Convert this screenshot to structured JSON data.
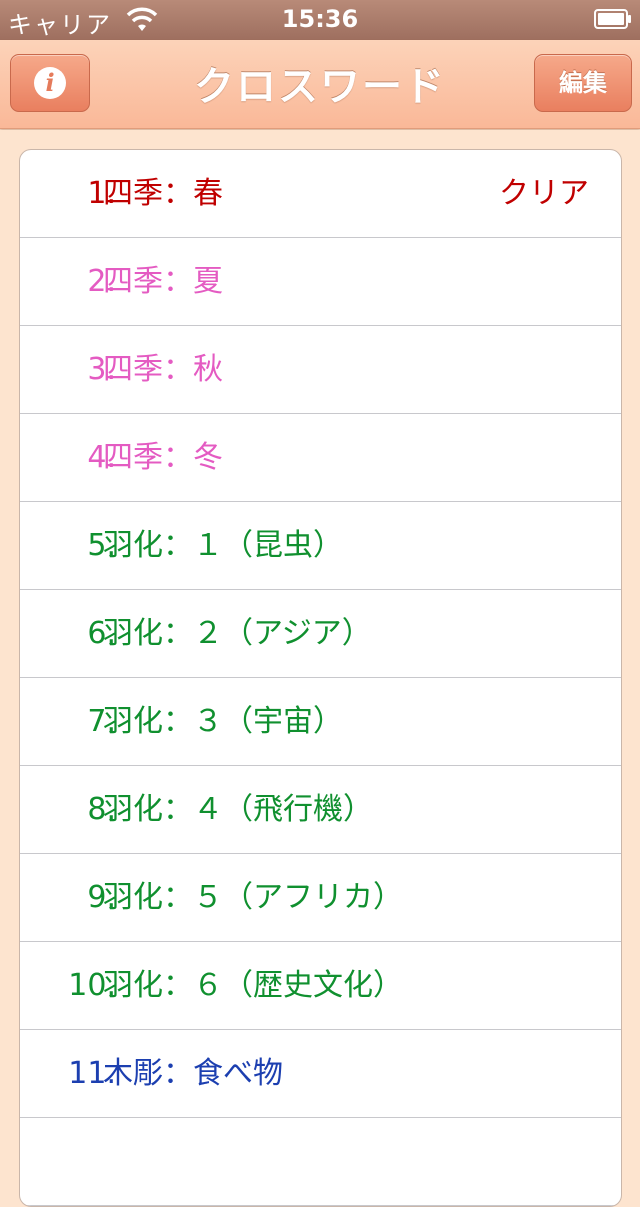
{
  "status_bar": {
    "carrier": "キャリア",
    "time": "15:36"
  },
  "nav": {
    "title": "クロスワード",
    "info_glyph": "i",
    "edit_label": "編集"
  },
  "colors": {
    "cleared": "#c00000",
    "season": "#e45bc2",
    "hatching": "#10902f",
    "wood": "#1c3fb0"
  },
  "puzzles": [
    {
      "number": "1.",
      "title": "四季：春",
      "status": "クリア",
      "color": "red"
    },
    {
      "number": "2.",
      "title": "四季：夏",
      "status": "",
      "color": "pink"
    },
    {
      "number": "3.",
      "title": "四季：秋",
      "status": "",
      "color": "pink"
    },
    {
      "number": "4.",
      "title": "四季：冬",
      "status": "",
      "color": "pink"
    },
    {
      "number": "5.",
      "title": "羽化：１（昆虫）",
      "status": "",
      "color": "green"
    },
    {
      "number": "6.",
      "title": "羽化：２（アジア）",
      "status": "",
      "color": "green"
    },
    {
      "number": "7.",
      "title": "羽化：３（宇宙）",
      "status": "",
      "color": "green"
    },
    {
      "number": "8.",
      "title": "羽化：４（飛行機）",
      "status": "",
      "color": "green"
    },
    {
      "number": "9.",
      "title": "羽化：５（アフリカ）",
      "status": "",
      "color": "green"
    },
    {
      "number": "10.",
      "title": "羽化：６（歴史文化）",
      "status": "",
      "color": "green"
    },
    {
      "number": "11.",
      "title": "木彫：食べ物",
      "status": "",
      "color": "blue"
    },
    {
      "number": "",
      "title": "",
      "status": "",
      "color": "blue"
    }
  ]
}
